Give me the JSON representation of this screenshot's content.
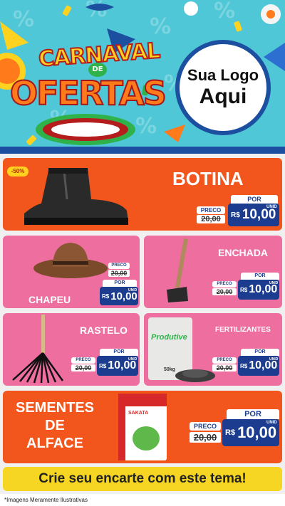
{
  "header": {
    "title_top": "CARNAVAL",
    "title_connector": "DE",
    "title_bottom": "OFERTAS",
    "logo_line1": "Sua Logo",
    "logo_line2": "Aqui"
  },
  "products": [
    {
      "name": "BOTINA",
      "discount": "-50%",
      "por_label": "POR",
      "preco_label": "PRECO",
      "old_price": "20,00",
      "currency": "R$",
      "price": "10,00",
      "unit": "UNID"
    },
    {
      "name": "CHAPEU",
      "por_label": "POR",
      "preco_label": "PRECO",
      "old_price": "20,00",
      "currency": "R$",
      "price": "10,00",
      "unit": "UNID"
    },
    {
      "name": "ENCHADA",
      "por_label": "POR",
      "preco_label": "PRECO",
      "old_price": "20,00",
      "currency": "R$",
      "price": "10,00",
      "unit": "UNID"
    },
    {
      "name": "RASTELO",
      "por_label": "POR",
      "preco_label": "PRECO",
      "old_price": "20,00",
      "currency": "R$",
      "price": "10,00",
      "unit": "UNID"
    },
    {
      "name": "FERTILIZANTES",
      "package_brand": "Produtive",
      "package_weight": "50kg",
      "por_label": "POR",
      "preco_label": "PRECO",
      "old_price": "20,00",
      "currency": "R$",
      "price": "10,00",
      "unit": "UNID"
    },
    {
      "name_line1": "SEMENTES",
      "name_line2": "DE",
      "name_line3": "ALFACE",
      "package_brand": "SAKATA",
      "por_label": "POR",
      "preco_label": "PRECO",
      "old_price": "20,00",
      "currency": "R$",
      "price": "10,00",
      "unit": "UNID"
    }
  ],
  "banner": "Crie seu encarte com este tema!",
  "disclaimer": "*Imagens Meramente Ilustrativas",
  "colors": {
    "orange": "#f2561d",
    "pink": "#ee6f9f",
    "navy": "#1c3d8f",
    "sky": "#4fc7d6",
    "yellow": "#f6d622"
  }
}
